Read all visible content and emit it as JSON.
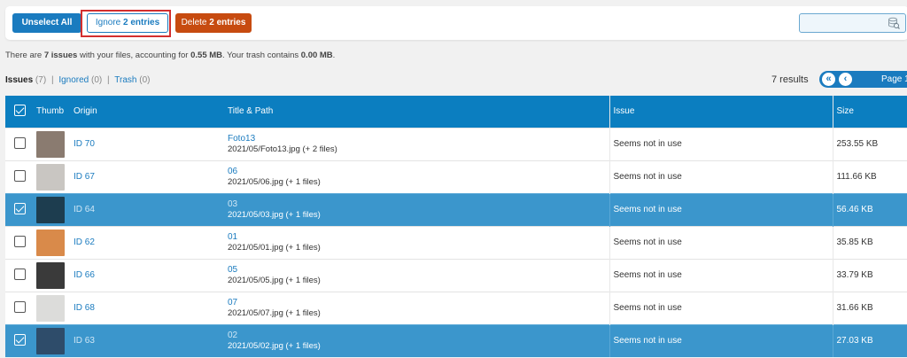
{
  "toolbar": {
    "unselect_label": "Unselect All",
    "ignore_prefix": "Ignore",
    "ignore_count": "2 entries",
    "delete_prefix": "Delete",
    "delete_count": "2 entries",
    "search_value": "",
    "search_icon": "database-search-icon"
  },
  "summary": {
    "part1": "There are ",
    "issues": "7 issues",
    "part2": " with your files, accounting for ",
    "size": "0.55 MB",
    "part3": ". Your trash contains ",
    "trash": "0.00 MB",
    "part4": "."
  },
  "tabs": {
    "issues_label": "Issues",
    "issues_count": "(7)",
    "ignored_label": "Ignored",
    "ignored_count": "(0)",
    "trash_label": "Trash",
    "trash_count": "(0)"
  },
  "pagination": {
    "results": "7 results",
    "first_icon": "«",
    "prev_icon": "‹",
    "page_label": "Page 1"
  },
  "table": {
    "headers": {
      "thumb": "Thumb",
      "origin": "Origin",
      "title": "Title & Path",
      "issue": "Issue",
      "size": "Size"
    },
    "rows": [
      {
        "origin": "ID 70",
        "title": "Foto13",
        "path": "2021/05/Foto13.jpg (+ 2 files)",
        "issue": "Seems not in use",
        "size": "253.55 KB",
        "selected": false,
        "thumb_color": "#8a7b70"
      },
      {
        "origin": "ID 67",
        "title": "06",
        "path": "2021/05/06.jpg (+ 1 files)",
        "issue": "Seems not in use",
        "size": "111.66 KB",
        "selected": false,
        "thumb_color": "#c9c6c2"
      },
      {
        "origin": "ID 64",
        "title": "03",
        "path": "2021/05/03.jpg (+ 1 files)",
        "issue": "Seems not in use",
        "size": "56.46 KB",
        "selected": true,
        "thumb_color": "#1d3d4f"
      },
      {
        "origin": "ID 62",
        "title": "01",
        "path": "2021/05/01.jpg (+ 1 files)",
        "issue": "Seems not in use",
        "size": "35.85 KB",
        "selected": false,
        "thumb_color": "#d98a4a"
      },
      {
        "origin": "ID 66",
        "title": "05",
        "path": "2021/05/05.jpg (+ 1 files)",
        "issue": "Seems not in use",
        "size": "33.79 KB",
        "selected": false,
        "thumb_color": "#3a3a3a"
      },
      {
        "origin": "ID 68",
        "title": "07",
        "path": "2021/05/07.jpg (+ 1 files)",
        "issue": "Seems not in use",
        "size": "31.66 KB",
        "selected": false,
        "thumb_color": "#dcdcda"
      },
      {
        "origin": "ID 63",
        "title": "02",
        "path": "2021/05/02.jpg (+ 1 files)",
        "issue": "Seems not in use",
        "size": "27.03 KB",
        "selected": true,
        "thumb_color": "#2e4c6a"
      }
    ]
  },
  "colors": {
    "accent": "#1a7bbf",
    "header": "#0b7ec0",
    "selected_row": "#3b96cc",
    "delete": "#c74b10",
    "highlight": "#d32f2f"
  }
}
